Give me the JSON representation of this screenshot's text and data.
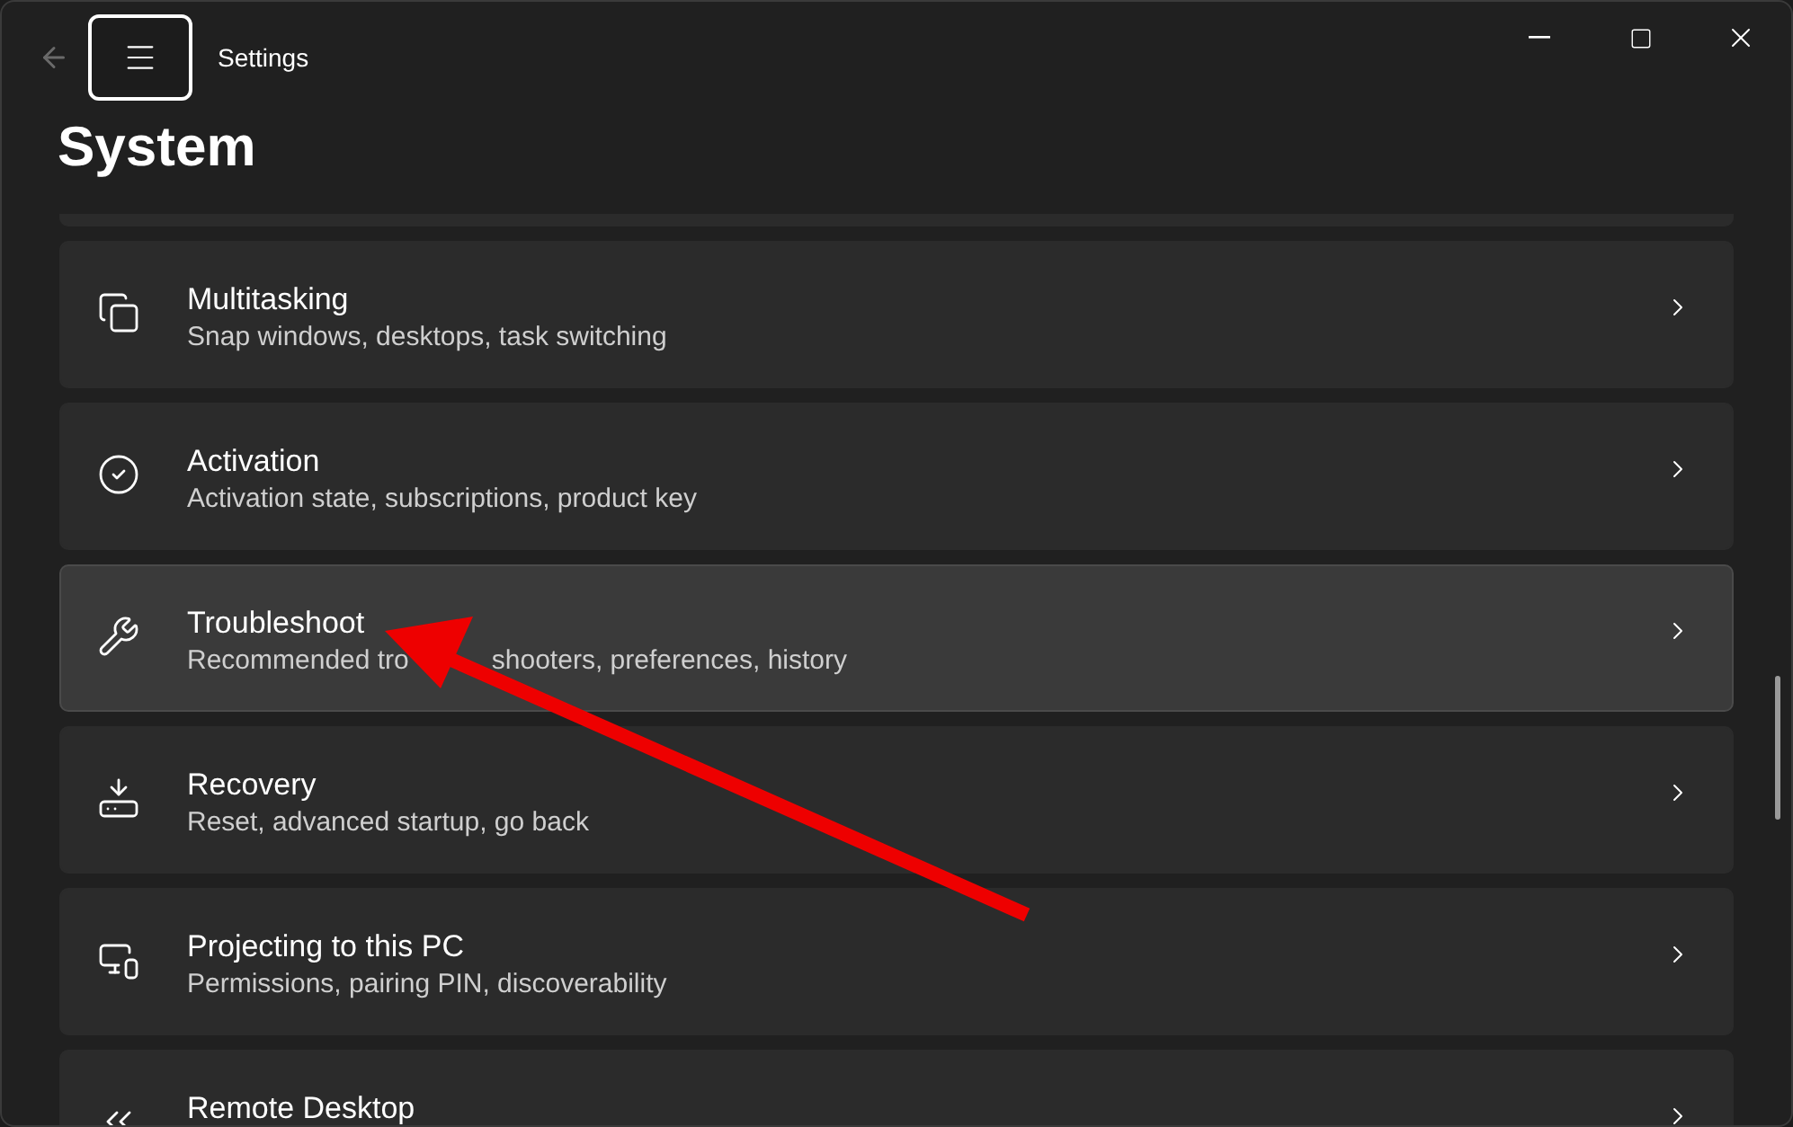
{
  "window": {
    "title": "Settings",
    "back_disabled": true
  },
  "page": {
    "title": "System"
  },
  "items": [
    {
      "title": "Multitasking",
      "subtitle": [
        "Snap windows, desktops, task switching"
      ],
      "highlighted": false
    },
    {
      "title": "Activation",
      "subtitle": [
        "Activation state, subscriptions, product key"
      ],
      "highlighted": false
    },
    {
      "title": "Troubleshoot",
      "subtitle": [
        "Recommended tro",
        "shooters, preferences, history"
      ],
      "highlighted": true
    },
    {
      "title": "Recovery",
      "subtitle": [
        "Reset, advanced startup, go back"
      ],
      "highlighted": false
    },
    {
      "title": "Projecting to this PC",
      "subtitle": [
        "Permissions, pairing PIN, discoverability"
      ],
      "highlighted": false
    },
    {
      "title": "Remote Desktop",
      "highlighted": false
    }
  ]
}
